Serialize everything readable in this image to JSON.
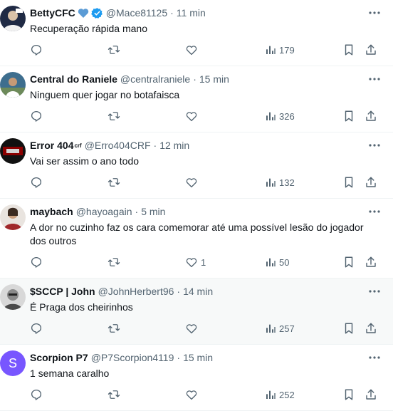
{
  "tweets": [
    {
      "display_name": "BettyCFC",
      "suffix_emoji": "blue-heart-icon",
      "verified": true,
      "handle": "@Mace81125",
      "time": "11 min",
      "text": "Recuperação rápida mano",
      "likes": "",
      "views": "179",
      "avatar": {
        "icon": "profile-photo",
        "color": "#1f2a44"
      }
    },
    {
      "display_name": "Central do Raniele",
      "handle": "@centralraniele",
      "time": "15 min",
      "text": "Ninguem quer jogar no botafaisca",
      "likes": "",
      "views": "326",
      "avatar": {
        "icon": "profile-photo",
        "color": "#3e6e8e"
      }
    },
    {
      "display_name": "Error 404",
      "name_sup": "crf",
      "handle": "@Erro404CRF",
      "time": "12 min",
      "text": "Vai ser assim o ano todo",
      "likes": "",
      "views": "132",
      "avatar": {
        "icon": "profile-photo",
        "color": "#8b0000"
      }
    },
    {
      "display_name": "maybach",
      "handle": "@hayoagain",
      "time": "5 min",
      "text": "A dor no cuzinho faz os cara comemorar até uma possível lesão do jogador dos outros",
      "likes": "1",
      "views": "50",
      "avatar": {
        "icon": "profile-photo",
        "color": "#a0282b"
      }
    },
    {
      "display_name": "$SCCP | John",
      "handle": "@JohnHerbert96",
      "time": "14 min",
      "text": "É Praga dos cheirinhos",
      "likes": "",
      "views": "257",
      "avatar": {
        "icon": "profile-photo",
        "color": "#b8b8b8"
      }
    },
    {
      "display_name": "Scorpion P7",
      "handle": "@P7Scorpion4119",
      "time": "15 min",
      "text": "1 semana caralho",
      "likes": "",
      "views": "252",
      "avatar": {
        "icon": "initial-avatar",
        "letter": "S",
        "color": "#7856ff"
      }
    }
  ],
  "colors": {
    "text": "#0f1419",
    "muted": "#536471",
    "verified": "#1d9bf0",
    "heart": "#5b9bd5",
    "divider": "#eff3f4",
    "highlight_bg": "#f7f9f9"
  }
}
